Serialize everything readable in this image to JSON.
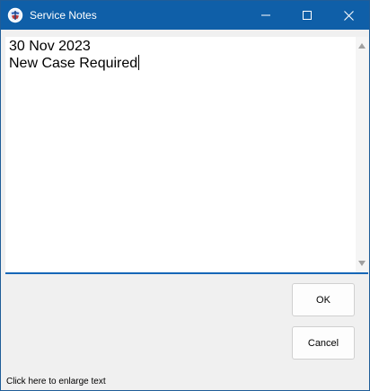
{
  "window": {
    "title": "Service Notes",
    "accent_color": "#0f5fa8",
    "controls": {
      "minimize_icon": "minimize-icon",
      "maximize_icon": "maximize-icon",
      "close_icon": "close-icon"
    }
  },
  "notes": {
    "value": "30 Nov 2023\nNew Case Required"
  },
  "buttons": {
    "ok_label": "OK",
    "cancel_label": "Cancel"
  },
  "footer": {
    "enlarge_link": "Click here to enlarge text"
  }
}
